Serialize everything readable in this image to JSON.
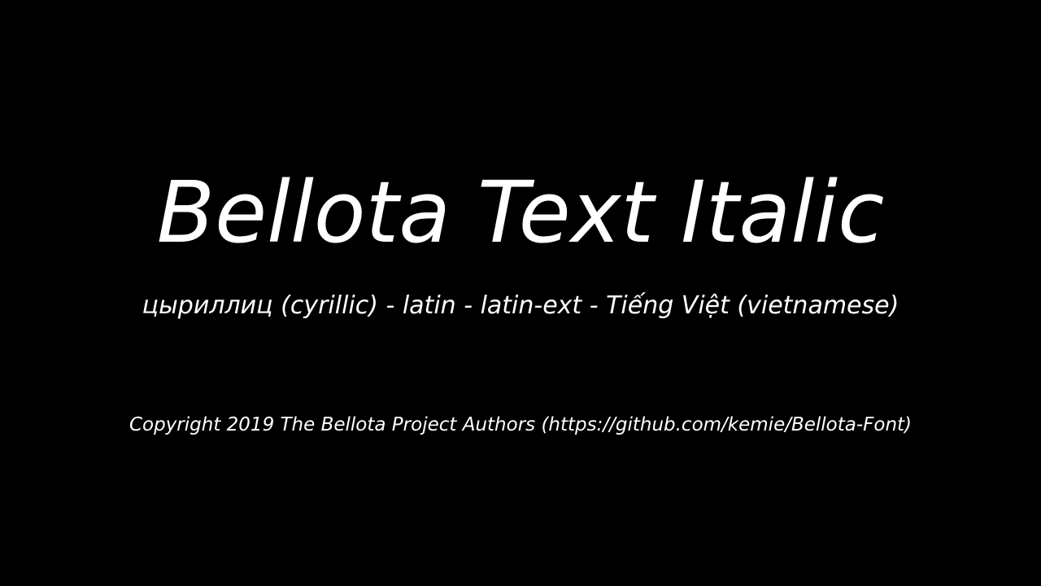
{
  "specimen": {
    "title": "Bellota Text Italic",
    "subsets": "цыриллиц (cyrillic) - latin - latin-ext - Tiếng Việt (vietnamese)",
    "copyright": "Copyright 2019 The Bellota Project Authors (https://github.com/kemie/Bellota-Font)"
  },
  "colors": {
    "background": "#000000",
    "text": "#ffffff"
  }
}
